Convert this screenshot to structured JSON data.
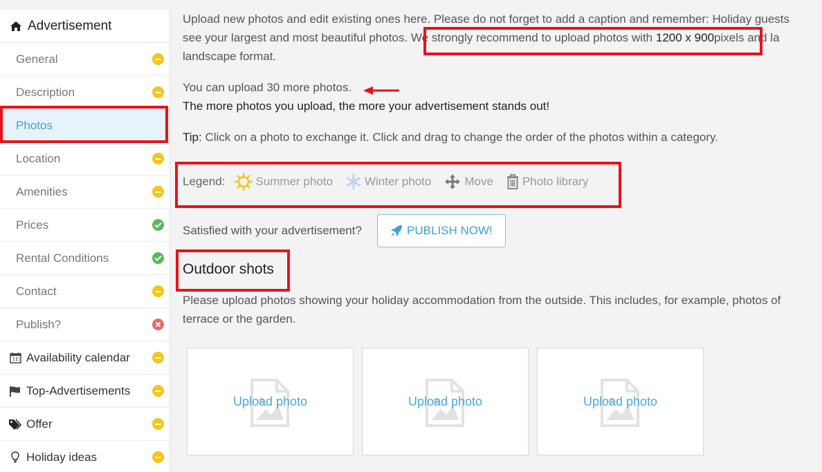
{
  "sidebar": {
    "header": "Advertisement",
    "items": [
      {
        "label": "General",
        "status": "pending"
      },
      {
        "label": "Description",
        "status": "pending"
      },
      {
        "label": "Photos",
        "status": "active"
      },
      {
        "label": "Location",
        "status": "pending"
      },
      {
        "label": "Amenities",
        "status": "pending"
      },
      {
        "label": "Prices",
        "status": "ok"
      },
      {
        "label": "Rental Conditions",
        "status": "ok"
      },
      {
        "label": "Contact",
        "status": "pending"
      },
      {
        "label": "Publish?",
        "status": "error"
      }
    ],
    "groups": [
      {
        "label": "Availability calendar",
        "icon": "calendar-icon",
        "status": "pending"
      },
      {
        "label": "Top-Advertisements",
        "icon": "flag-icon",
        "status": "pending"
      },
      {
        "label": "Offer",
        "icon": "tags-icon",
        "status": "pending"
      },
      {
        "label": "Holiday ideas",
        "icon": "lightbulb-icon",
        "status": "pending"
      }
    ]
  },
  "main": {
    "intro_line1": "Upload new photos and edit existing ones here. Please do not forget to add a caption and remember: Holiday guests",
    "intro_line2a": "see your largest and most beautiful photos.",
    "intro_line2b": "We strongly recommend to upload photos with",
    "intro_line2c": "1200 x 900",
    "intro_line2d": "pixels and la",
    "intro_line3": "landscape format.",
    "remaining": "You can upload 30 more photos.",
    "standout": "The more photos you upload, the more your advertisement stands out!",
    "tip_label": "Tip:",
    "tip_text": "Click on a photo to exchange it. Click and drag to change the order of the photos within a category.",
    "legend": {
      "title": "Legend:",
      "summer": "Summer photo",
      "winter": "Winter photo",
      "move": "Move",
      "library": "Photo library"
    },
    "publish_prompt": "Satisfied with your advertisement?",
    "publish_button": "PUBLISH NOW!",
    "section_title": "Outdoor shots",
    "section_desc1": "Please upload photos showing your holiday accommodation from the outside. This includes, for example, photos of",
    "section_desc2": "terrace or the garden.",
    "tiles": [
      "Upload photo",
      "Upload photo",
      "Upload photo"
    ]
  },
  "colors": {
    "accent": "#3ba1d8",
    "highlight": "#e8121c",
    "pending": "#f5c518",
    "ok": "#5cb85c",
    "error": "#e46a6a"
  }
}
